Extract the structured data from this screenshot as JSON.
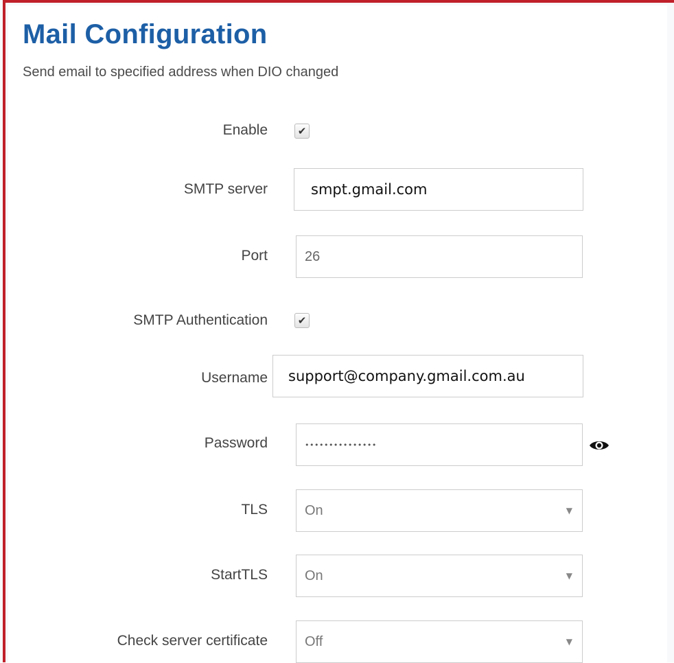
{
  "page": {
    "title": "Mail Configuration",
    "subtitle": "Send email to specified address when DIO changed"
  },
  "form": {
    "enable": {
      "label": "Enable",
      "checked": true,
      "check_glyph": "✔"
    },
    "smtp_server": {
      "label": "SMTP server",
      "value": "smpt.gmail.com"
    },
    "port": {
      "label": "Port",
      "value": "26"
    },
    "smtp_auth": {
      "label": "SMTP Authentication",
      "checked": true,
      "check_glyph": "✔"
    },
    "username": {
      "label": "Username",
      "value": "support@company.gmail.com.au"
    },
    "password": {
      "label": "Password",
      "value": "•••••••••••••••",
      "reveal_icon": "eye-icon"
    },
    "tls": {
      "label": "TLS",
      "value": "On",
      "caret": "▼"
    },
    "starttls": {
      "label": "StartTLS",
      "value": "On",
      "caret": "▼"
    },
    "check_cert": {
      "label": "Check server certificate",
      "value": "Off",
      "caret": "▼"
    }
  },
  "colors": {
    "title": "#1d5fa6",
    "accent_border": "#c0202a"
  }
}
